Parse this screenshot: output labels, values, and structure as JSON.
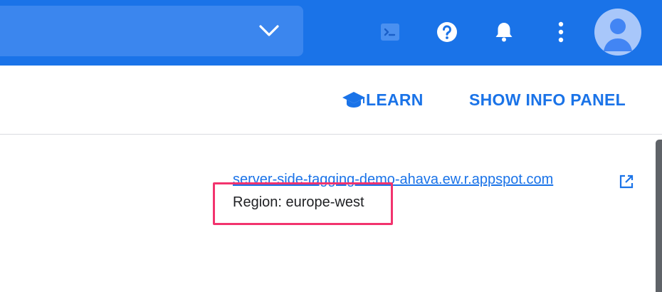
{
  "header": {
    "icons": [
      "cloud-shell-icon",
      "help-icon",
      "notifications-icon",
      "more-vert-icon",
      "account-avatar"
    ],
    "colors": {
      "bar": "#1a73e8",
      "avatar_bg": "#a8c7fa",
      "avatar_fg": "#4285f4"
    }
  },
  "actions": {
    "learn_label": "LEARN",
    "info_panel_label": "SHOW INFO PANEL"
  },
  "service": {
    "url": "server-side-tagging-demo-ahava.ew.r.appspot.com",
    "region": "Region: europe-west"
  },
  "annotation": {
    "highlight_color": "#f2336e"
  }
}
